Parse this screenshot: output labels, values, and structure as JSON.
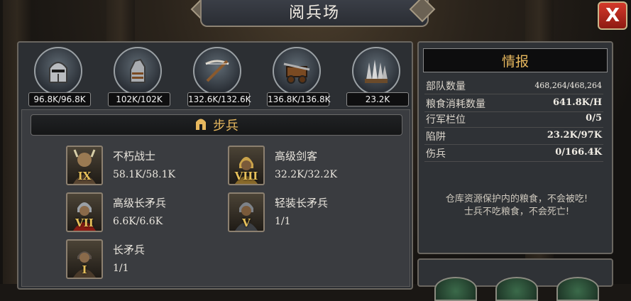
{
  "header": {
    "title": "阅兵场",
    "close_label": "X"
  },
  "top_stats": [
    {
      "icon": "knight-helmet-icon",
      "value": "96.8K/96.8K"
    },
    {
      "icon": "horse-armor-icon",
      "value": "102K/102K"
    },
    {
      "icon": "crossbow-icon",
      "value": "132.6K/132.6K"
    },
    {
      "icon": "siege-ram-icon",
      "value": "136.8K/136.8K"
    },
    {
      "icon": "spike-trap-icon",
      "value": "23.2K"
    }
  ],
  "section": {
    "icon": "infantry-helmet-icon",
    "title": "步兵"
  },
  "units": [
    {
      "name": "不朽战士",
      "count": "58.1K/58.1K",
      "rank": "IX"
    },
    {
      "name": "高级剑客",
      "count": "32.2K/32.2K",
      "rank": "VIII"
    },
    {
      "name": "高级长矛兵",
      "count": "6.6K/6.6K",
      "rank": "VII"
    },
    {
      "name": "轻装长矛兵",
      "count": "1/1",
      "rank": "V"
    },
    {
      "name": "长矛兵",
      "count": "1/1",
      "rank": "I"
    }
  ],
  "info": {
    "title": "情报",
    "rows": [
      {
        "label": "部队数量",
        "value": "468,264/468,264"
      },
      {
        "label": "粮食消耗数量",
        "value": "641.8K/H"
      },
      {
        "label": "行军栏位",
        "value": "0/5"
      },
      {
        "label": "陷阱",
        "value": "23.2K/97K"
      },
      {
        "label": "伤兵",
        "value": "0/166.4K"
      }
    ],
    "note_line1": "仓库资源保护内的粮食，不会被吃!",
    "note_line2": "士兵不吃粮食，不会死亡!"
  },
  "colors": {
    "accent_gold": "#e7b85e",
    "close_red": "#d4392a"
  }
}
